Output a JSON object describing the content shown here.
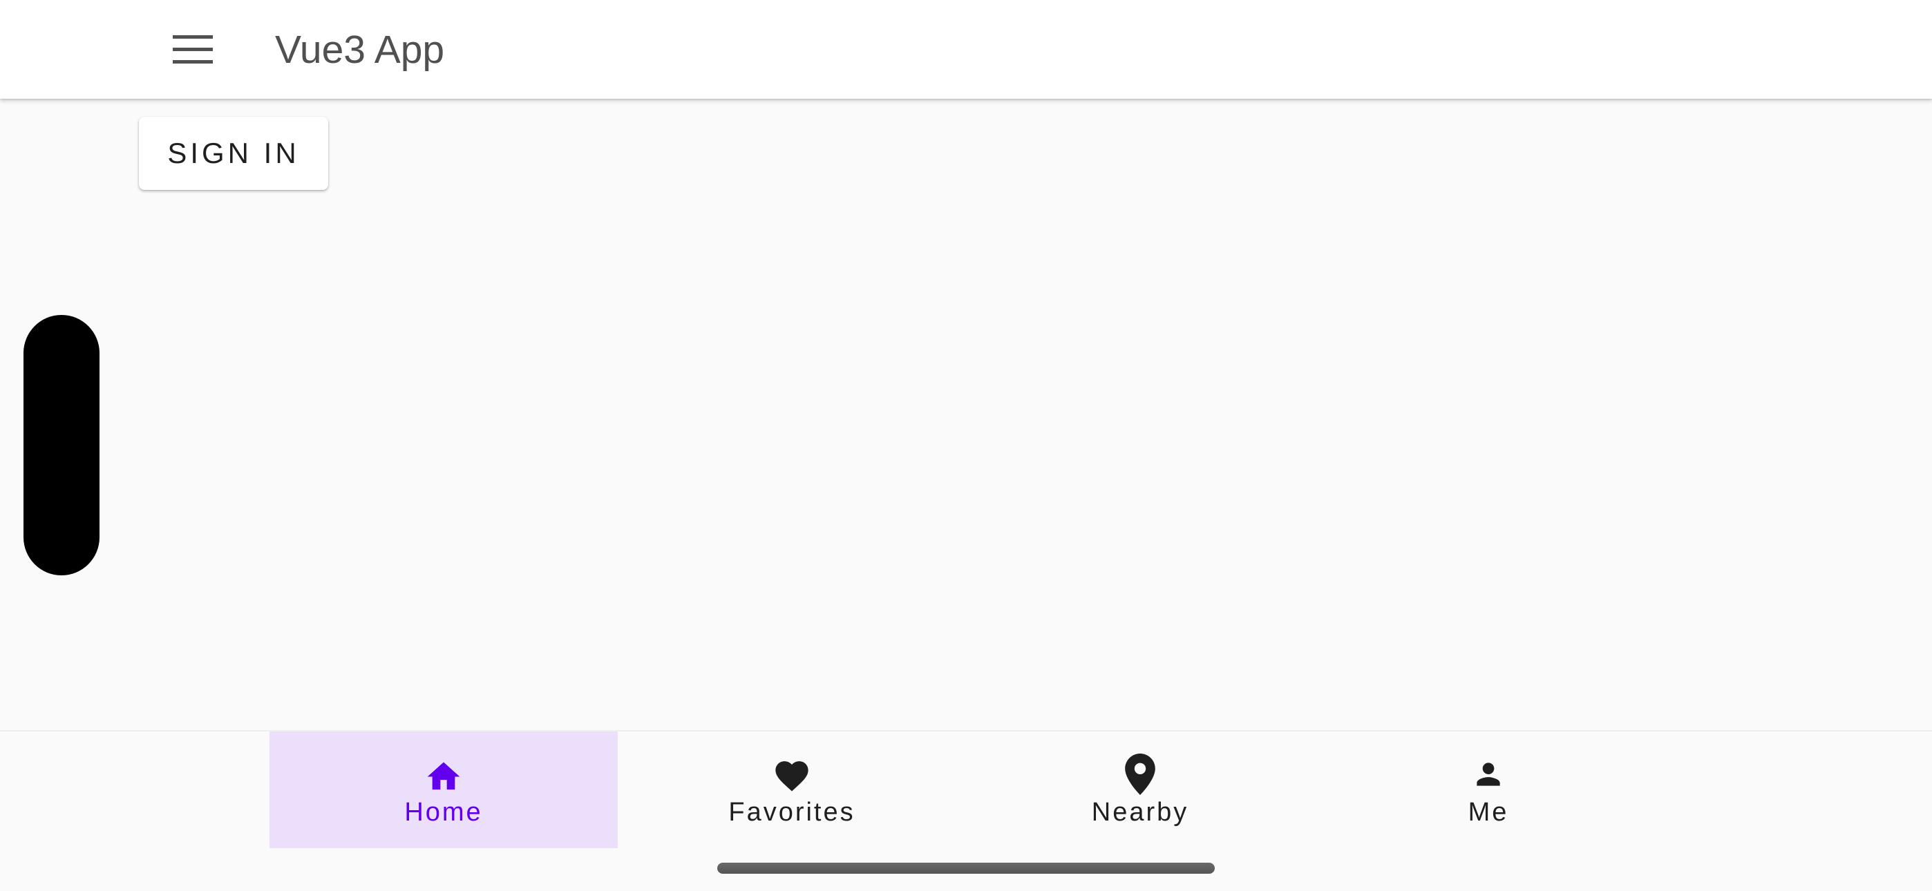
{
  "app_bar": {
    "title": "Vue3 App",
    "menu_icon": "hamburger-menu-icon"
  },
  "main": {
    "sign_in_label": "SIGN IN"
  },
  "bottom_nav": {
    "active_color": "#6200ee",
    "active_background": "#ecdffb",
    "items": [
      {
        "label": "Home",
        "icon": "home-icon",
        "active": true
      },
      {
        "label": "Favorites",
        "icon": "heart-icon",
        "active": false
      },
      {
        "label": "Nearby",
        "icon": "location-pin-icon",
        "active": false
      },
      {
        "label": "Me",
        "icon": "person-icon",
        "active": false
      }
    ]
  }
}
